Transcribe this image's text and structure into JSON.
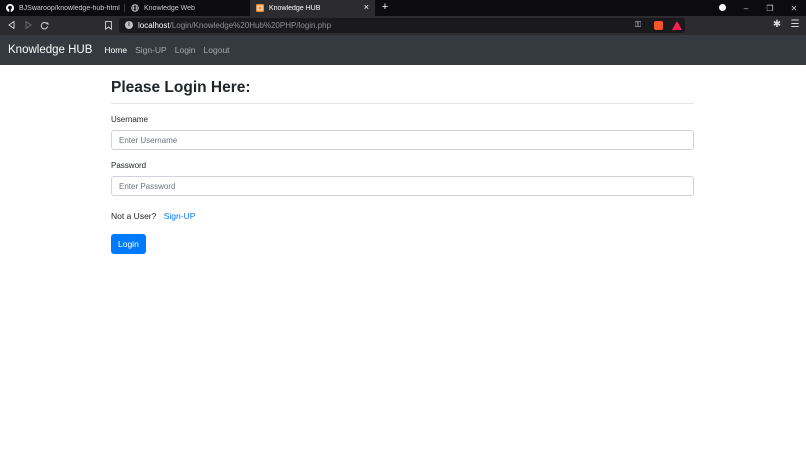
{
  "browser": {
    "tabs": [
      {
        "title": "BJSwaroop/knowledge-hub-html",
        "icon": "github-icon"
      },
      {
        "title": "Knowledge Web",
        "icon": "globe-icon"
      },
      {
        "title": "Knowledge HUB",
        "icon": "site-favicon",
        "active": true
      }
    ],
    "new_tab": "+",
    "close_tab": "×",
    "url": {
      "host": "localhost",
      "path": "/Login/Knowledge%20Hub%20PHP/login.php"
    },
    "window_controls": [
      "–",
      "❐",
      "✕"
    ],
    "colors": {
      "tabstrip": "#0c0c0f",
      "toolbar": "#2b2b30"
    }
  },
  "navbar": {
    "brand": "Knowledge HUB",
    "links": [
      {
        "label": "Home",
        "active": true
      },
      {
        "label": "Sign-UP"
      },
      {
        "label": "Login"
      },
      {
        "label": "Logout"
      }
    ],
    "colors": {
      "background": "#343a40"
    }
  },
  "form": {
    "heading": "Please Login Here:",
    "username_label": "Username",
    "username_placeholder": "Enter Username",
    "password_label": "Password",
    "password_placeholder": "Enter Password",
    "not_user_text": "Not a User?",
    "signup_link": "Sign-UP",
    "submit_label": "Login",
    "colors": {
      "primary": "#007bff"
    }
  }
}
